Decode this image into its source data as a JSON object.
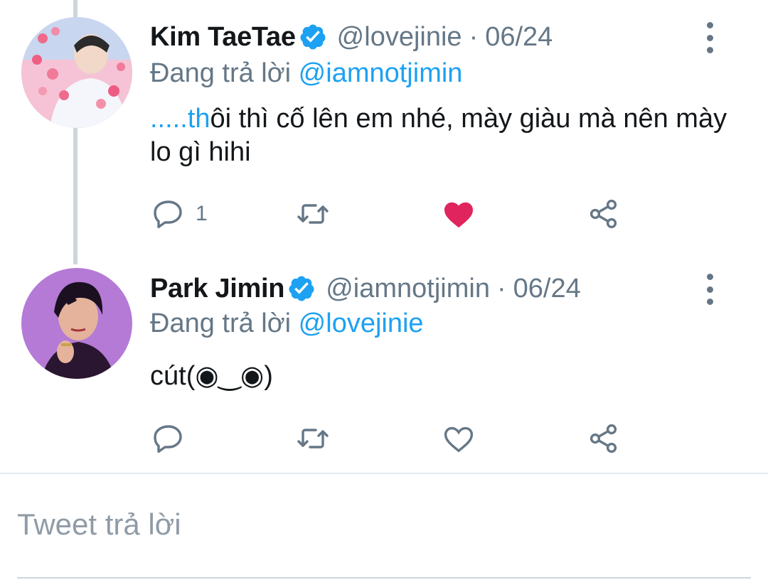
{
  "tweets": [
    {
      "name": "Kim TaeTae",
      "handle": "@lovejinie",
      "separator": "·",
      "date": "06/24",
      "replying_prefix": "Đang trả lời",
      "replying_to": "@iamnotjimin",
      "text_highlight": ".....th",
      "text_rest": "ôi thì cố lên em nhé, mày giàu mà nên mày lo gì hihi",
      "reply_count": "1",
      "liked": true,
      "avatar_colors": [
        "#f7c6d6",
        "#b8c7e8",
        "#f2f2f2"
      ]
    },
    {
      "name": "Park Jimin",
      "handle": "@iamnotjimin",
      "separator": "·",
      "date": "06/24",
      "replying_prefix": "Đang trả lời",
      "replying_to": "@lovejinie",
      "text": "cút(◉‿◉)",
      "reply_count": "",
      "liked": false,
      "avatar_colors": [
        "#b47ad6",
        "#1f1326",
        "#e8b6a0"
      ]
    }
  ],
  "reply_box": {
    "placeholder": "Tweet trả lời"
  },
  "colors": {
    "accent": "#1da1f2",
    "muted": "#657786",
    "like": "#e0245e",
    "verified": "#1da1f2"
  }
}
